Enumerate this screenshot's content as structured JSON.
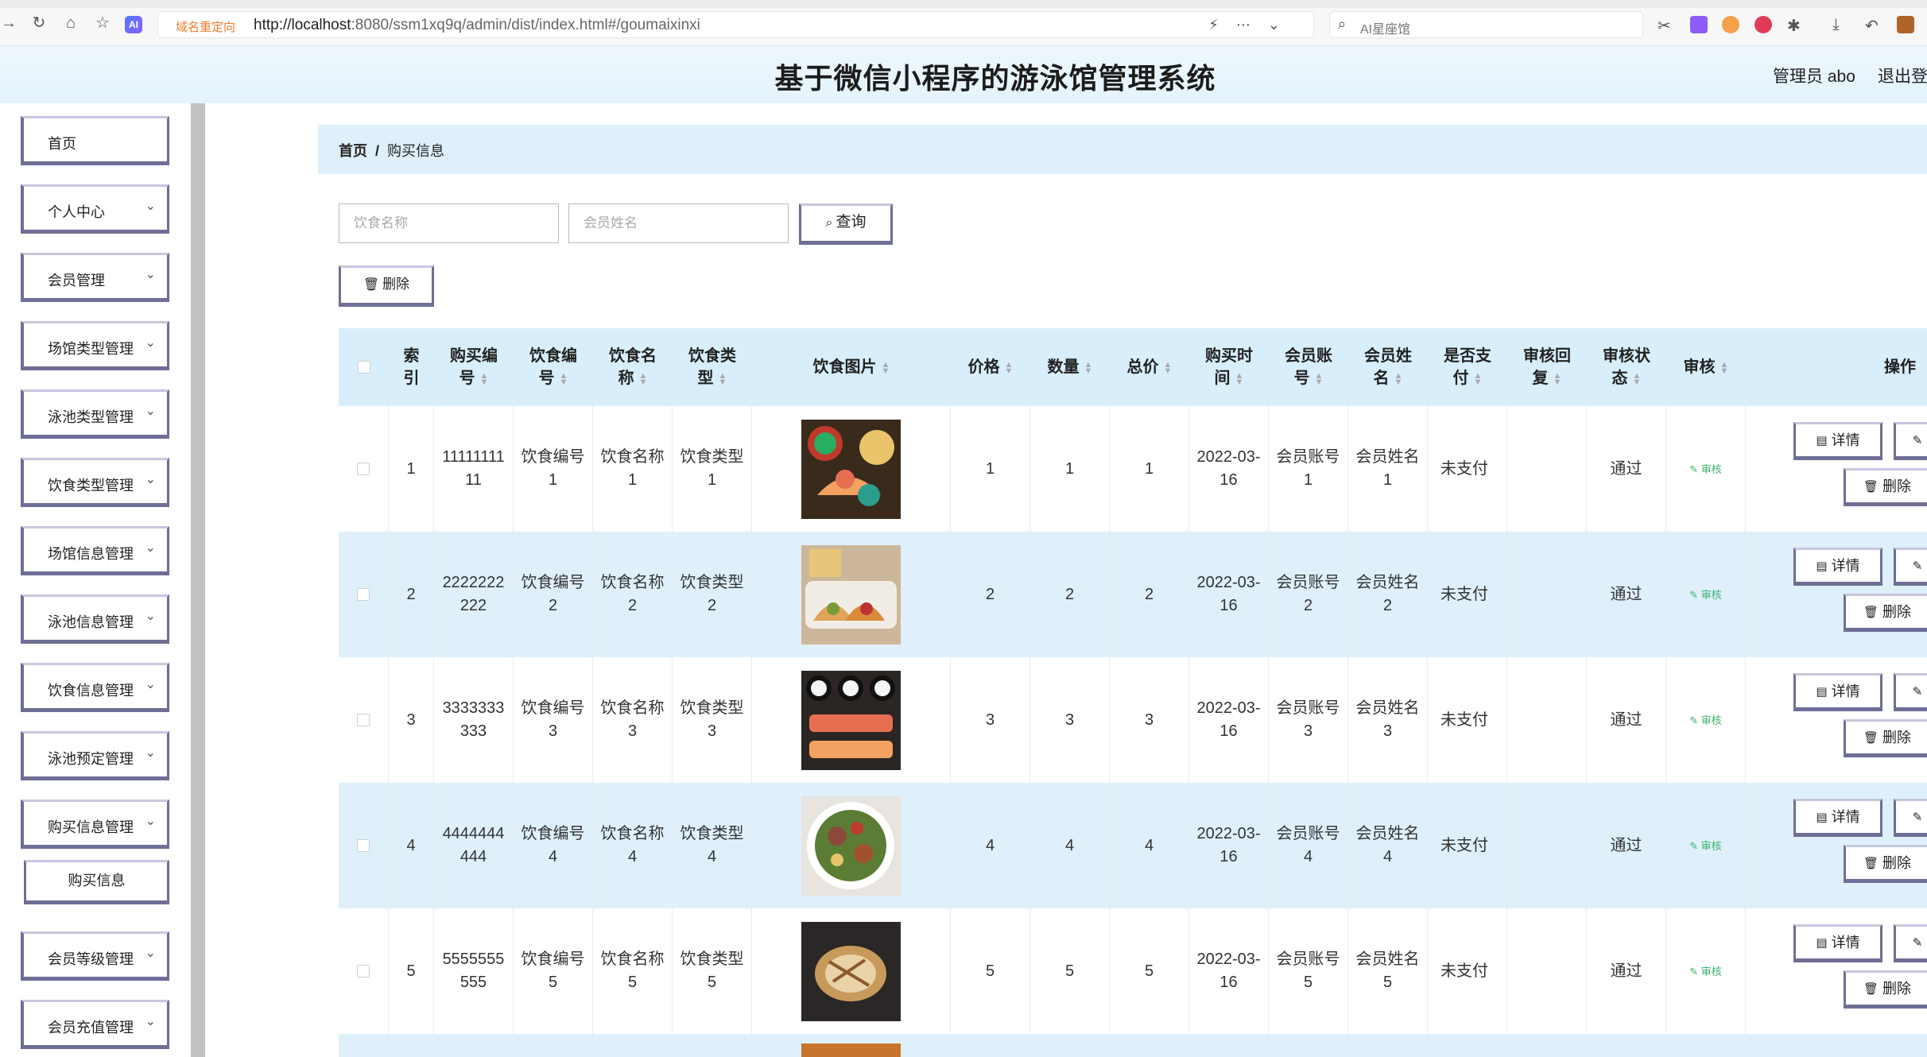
{
  "browser": {
    "redirect_tag": "域名重定向",
    "url_host": "http://localhost",
    "url_rest": ":8080/ssm1xq9q/admin/dist/index.html#/goumaixinxi",
    "search_text": "AI星座馆"
  },
  "header": {
    "title": "基于微信小程序的游泳馆管理系统",
    "admin": "管理员 abo",
    "logout": "退出登"
  },
  "sidebar": {
    "items": [
      {
        "label": "首页",
        "has_chevron": false
      },
      {
        "label": "个人中心",
        "has_chevron": true
      },
      {
        "label": "会员管理",
        "has_chevron": true
      },
      {
        "label": "场馆类型管理",
        "has_chevron": true
      },
      {
        "label": "泳池类型管理",
        "has_chevron": true
      },
      {
        "label": "饮食类型管理",
        "has_chevron": true
      },
      {
        "label": "场馆信息管理",
        "has_chevron": true
      },
      {
        "label": "泳池信息管理",
        "has_chevron": true
      },
      {
        "label": "饮食信息管理",
        "has_chevron": true
      },
      {
        "label": "泳池预定管理",
        "has_chevron": true
      },
      {
        "label": "购买信息管理",
        "has_chevron": true
      },
      {
        "label": "会员等级管理",
        "has_chevron": true
      },
      {
        "label": "会员充值管理",
        "has_chevron": true
      }
    ],
    "active_sub": "购买信息"
  },
  "breadcrumb": {
    "home": "首页",
    "sep": "/",
    "current": "购买信息"
  },
  "search": {
    "food_name_placeholder": "饮食名称",
    "member_name_placeholder": "会员姓名",
    "query_label": "查询",
    "delete_label": "删除"
  },
  "table": {
    "headers": [
      "索引",
      "购买编号",
      "饮食编号",
      "饮食名称",
      "饮食类型",
      "饮食图片",
      "价格",
      "数量",
      "总价",
      "购买时间",
      "会员账号",
      "会员姓名",
      "是否支付",
      "审核回复",
      "审核状态",
      "审核",
      "操作"
    ],
    "header_lines": [
      [
        "索",
        "引"
      ],
      [
        "购买编",
        "号"
      ],
      [
        "饮食编",
        "号"
      ],
      [
        "饮食名",
        "称"
      ],
      [
        "饮食类",
        "型"
      ],
      [
        "饮食图片"
      ],
      [
        "价格"
      ],
      [
        "数量"
      ],
      [
        "总价"
      ],
      [
        "购买时",
        "间"
      ],
      [
        "会员账",
        "号"
      ],
      [
        "会员姓",
        "名"
      ],
      [
        "是否支",
        "付"
      ],
      [
        "审核回",
        "复"
      ],
      [
        "审核状",
        "态"
      ],
      [
        "审核"
      ],
      [
        "操作"
      ]
    ],
    "rows": [
      {
        "index": "1",
        "buy_no": "1111111111",
        "food_no": "饮食编号1",
        "food_name": "饮食名称1",
        "food_type": "饮食类型1",
        "image": "tacos-plate",
        "price": "1",
        "qty": "1",
        "total": "1",
        "time": "2022-03-16",
        "account": "会员账号1",
        "member": "会员姓名1",
        "paid": "未支付",
        "reply": "",
        "status": "通过",
        "audit": "审核"
      },
      {
        "index": "2",
        "buy_no": "2222222222",
        "food_no": "饮食编号2",
        "food_name": "饮食名称2",
        "food_type": "饮食类型2",
        "image": "tacos-platter",
        "price": "2",
        "qty": "2",
        "total": "2",
        "time": "2022-03-16",
        "account": "会员账号2",
        "member": "会员姓名2",
        "paid": "未支付",
        "reply": "",
        "status": "通过",
        "audit": "审核"
      },
      {
        "index": "3",
        "buy_no": "3333333333",
        "food_no": "饮食编号3",
        "food_name": "饮食名称3",
        "food_type": "饮食类型3",
        "image": "sushi-rolls",
        "price": "3",
        "qty": "3",
        "total": "3",
        "time": "2022-03-16",
        "account": "会员账号3",
        "member": "会员姓名3",
        "paid": "未支付",
        "reply": "",
        "status": "通过",
        "audit": "审核"
      },
      {
        "index": "4",
        "buy_no": "4444444444",
        "food_no": "饮食编号4",
        "food_name": "饮食名称4",
        "food_type": "饮食类型4",
        "image": "salad-bowl",
        "price": "4",
        "qty": "4",
        "total": "4",
        "time": "2022-03-16",
        "account": "会员账号4",
        "member": "会员姓名4",
        "paid": "未支付",
        "reply": "",
        "status": "通过",
        "audit": "审核"
      },
      {
        "index": "5",
        "buy_no": "5555555555",
        "food_no": "饮食编号5",
        "food_name": "饮食名称5",
        "food_type": "饮食类型5",
        "image": "bread-loaf",
        "price": "5",
        "qty": "5",
        "total": "5",
        "time": "2022-03-16",
        "account": "会员账号5",
        "member": "会员姓名5",
        "paid": "未支付",
        "reply": "",
        "status": "通过",
        "audit": "审核"
      }
    ],
    "row_actions": {
      "detail": "详情",
      "delete": "删除"
    }
  },
  "colors": {
    "accent_border": "#6e6e96",
    "header_bg": "#d8eefb",
    "row_alt": "#dff0fb",
    "audit_green": "#39b36e"
  }
}
